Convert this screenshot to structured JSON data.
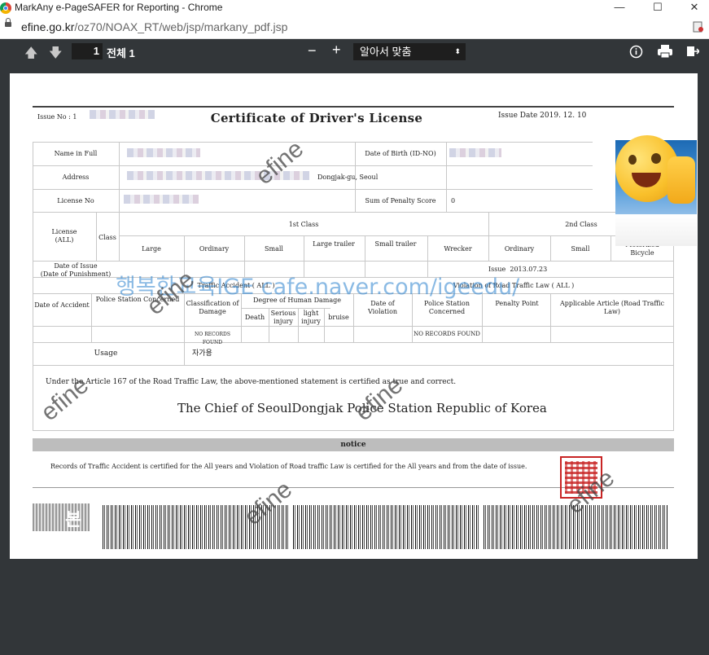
{
  "window": {
    "title": "MarkAny e-PageSAFER for Reporting - Chrome"
  },
  "address": {
    "host": "efine.go.kr",
    "path": "/oz70/NOAX_RT/web/jsp/markany_pdf.jsp"
  },
  "toolbar": {
    "page_number": "1",
    "page_total": "전체 1",
    "zoom": "알아서 맞춤",
    "minus": "−",
    "plus": "+"
  },
  "doc": {
    "issue_no_label": "Issue No : 1",
    "title": "Certificate  of  Driver's  License",
    "issue_date": "Issue Date 2019. 12. 10",
    "name_label": "Name in Full",
    "dob_label": "Date of Birth (ID-NO)",
    "address_label": "Address",
    "address_value": "Dongjak-gu, Seoul",
    "license_no_label": "License No",
    "penalty_label": "Sum of Penalty Score",
    "penalty_value": "0",
    "license_all_1": "License",
    "license_all_2": "(ALL)",
    "class_label": "Class",
    "first_class": "1st Class",
    "second_class": "2nd Class",
    "classes": [
      "Large",
      "Ordinary",
      "Small",
      "Large trailer",
      "Small trailer",
      "Wrecker",
      "Ordinary",
      "Small",
      "Motorized Bicycle"
    ],
    "date_issue_1": "Date of Issue",
    "date_issue_2": "(Date of Punishment)",
    "issue_cell": "Issue",
    "issue_cell_date": "2013.07.23",
    "traffic_accident": "Traffic Accident ( ALL )",
    "violation": "Violation of Road Traffic Law ( ALL )",
    "col_date_accident": "Date of Accident",
    "col_police": "Police Station Concerned",
    "col_class_damage": "Classification of Damage",
    "col_degree": "Degree of Human Damage",
    "col_death": "Death",
    "col_serious": "Serious injury",
    "col_light": "light injury",
    "col_bruise": "bruise",
    "col_date_violation": "Date of Violation",
    "col_police2": "Police Station Concerned",
    "col_penalty": "Penalty Point",
    "col_article": "Applicable Article (Road Traffic Law)",
    "no_records": "NO RECORDS FOUND",
    "no_records2": "NO RECORDS FOUND",
    "usage_label": "Usage",
    "usage_value": "자가용",
    "statement": "Under the Article 167 of the Road Traffic Law, the above-mentioned statement is certified as true and correct.",
    "chief": "The Chief of SeoulDongjak Police Station Republic of Korea",
    "notice_label": "notice",
    "notice_text": "Records of Traffic Accident  is certified for the All years and    Violation of Road traffic Law is certified for the All years and from the date of issue.",
    "watermark": "efine",
    "overlay_text": "행복한교육IGE cafe.naver.com/igeedu/",
    "bottom_label": "본"
  }
}
